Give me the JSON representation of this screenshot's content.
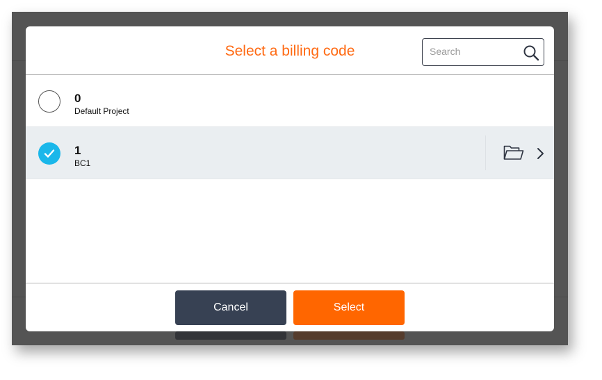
{
  "dialog": {
    "title": "Select a billing code",
    "search": {
      "placeholder": "Search",
      "value": ""
    },
    "items": [
      {
        "code": "0",
        "name": "Default Project",
        "selected": false
      },
      {
        "code": "1",
        "name": "BC1",
        "selected": true
      }
    ],
    "cancel_label": "Cancel",
    "select_label": "Select"
  },
  "colors": {
    "accent": "#ff6a13",
    "primary_button": "#ff6600",
    "secondary_button": "#374153",
    "check": "#1ab7ea"
  }
}
